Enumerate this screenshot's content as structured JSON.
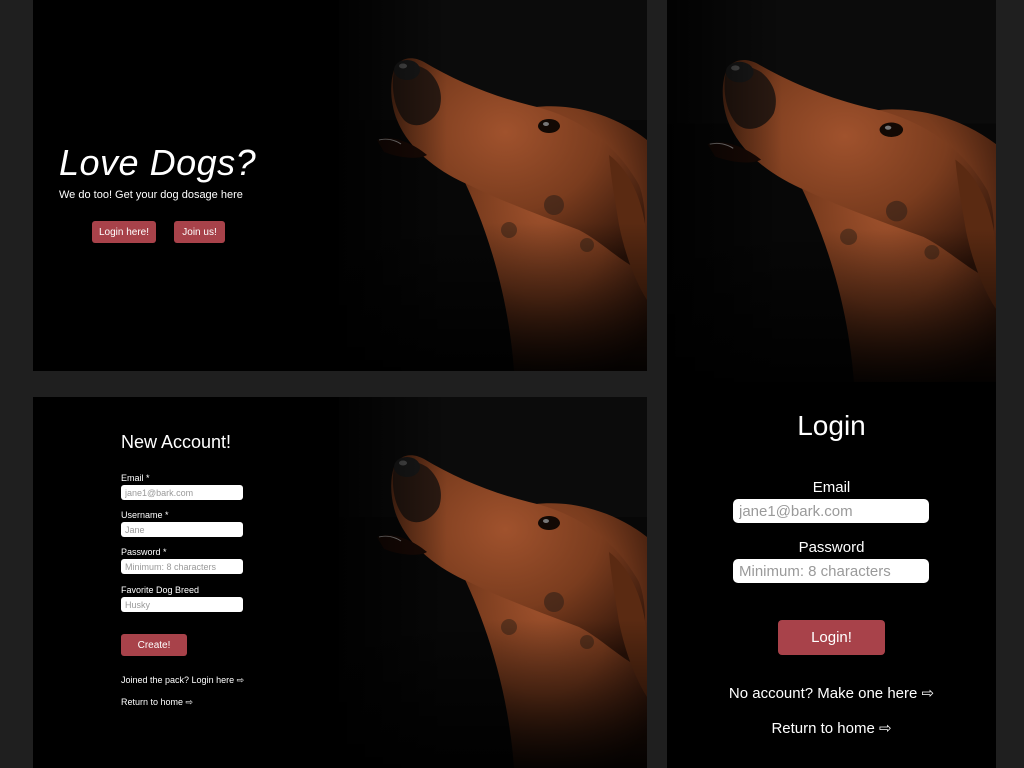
{
  "hero": {
    "title": "Love Dogs?",
    "subtitle": "We do too! Get your dog dosage here",
    "login_button": "Login here!",
    "join_button": "Join us!"
  },
  "signup": {
    "title": "New Account!",
    "fields": [
      {
        "label": "Email *",
        "placeholder": "jane1@bark.com"
      },
      {
        "label": "Username *",
        "placeholder": "Jane"
      },
      {
        "label": "Password *",
        "placeholder": "Minimum: 8 characters"
      },
      {
        "label": "Favorite Dog Breed",
        "placeholder": "Husky"
      }
    ],
    "create_button": "Create!",
    "login_link": "Joined the pack? Login here ⇨",
    "home_link": "Return to home ⇨"
  },
  "login": {
    "title": "Login",
    "email_label": "Email",
    "email_placeholder": "jane1@bark.com",
    "password_label": "Password",
    "password_placeholder": "Minimum: 8 characters",
    "login_button": "Login!",
    "signup_link": "No account? Make one here ⇨",
    "home_link": "Return to home ⇨"
  },
  "colors": {
    "accent": "#a8424a",
    "page_background": "#1f1f1f",
    "panel_background": "#000000"
  },
  "images": {
    "dog_photo": "dog-howling-photo"
  }
}
